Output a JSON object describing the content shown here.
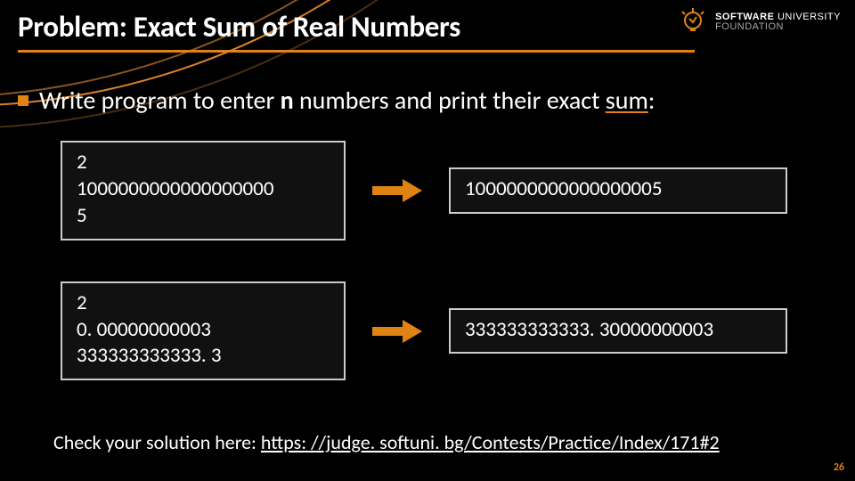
{
  "title": "Problem: Exact Sum of Real Numbers",
  "logo": {
    "line1_bold": "SOFTWARE",
    "line1_rest": " UNIVERSITY",
    "line2": "FOUNDATION"
  },
  "bullet": {
    "prefix": "Write program to enter ",
    "n": "n",
    "mid": " numbers and print their exact ",
    "sum": "sum",
    "suffix": ":"
  },
  "examples": [
    {
      "input": "2\n1000000000000000000\n5",
      "output": "1000000000000000005"
    },
    {
      "input": "2\n0. 00000000003\n333333333333. 3",
      "output": "333333333333. 30000000003"
    }
  ],
  "check": {
    "prefix": "Check your solution here: ",
    "url_text": "https: //judge. softuni. bg/Contests/Practice/Index/171#2"
  },
  "page_number": "26"
}
